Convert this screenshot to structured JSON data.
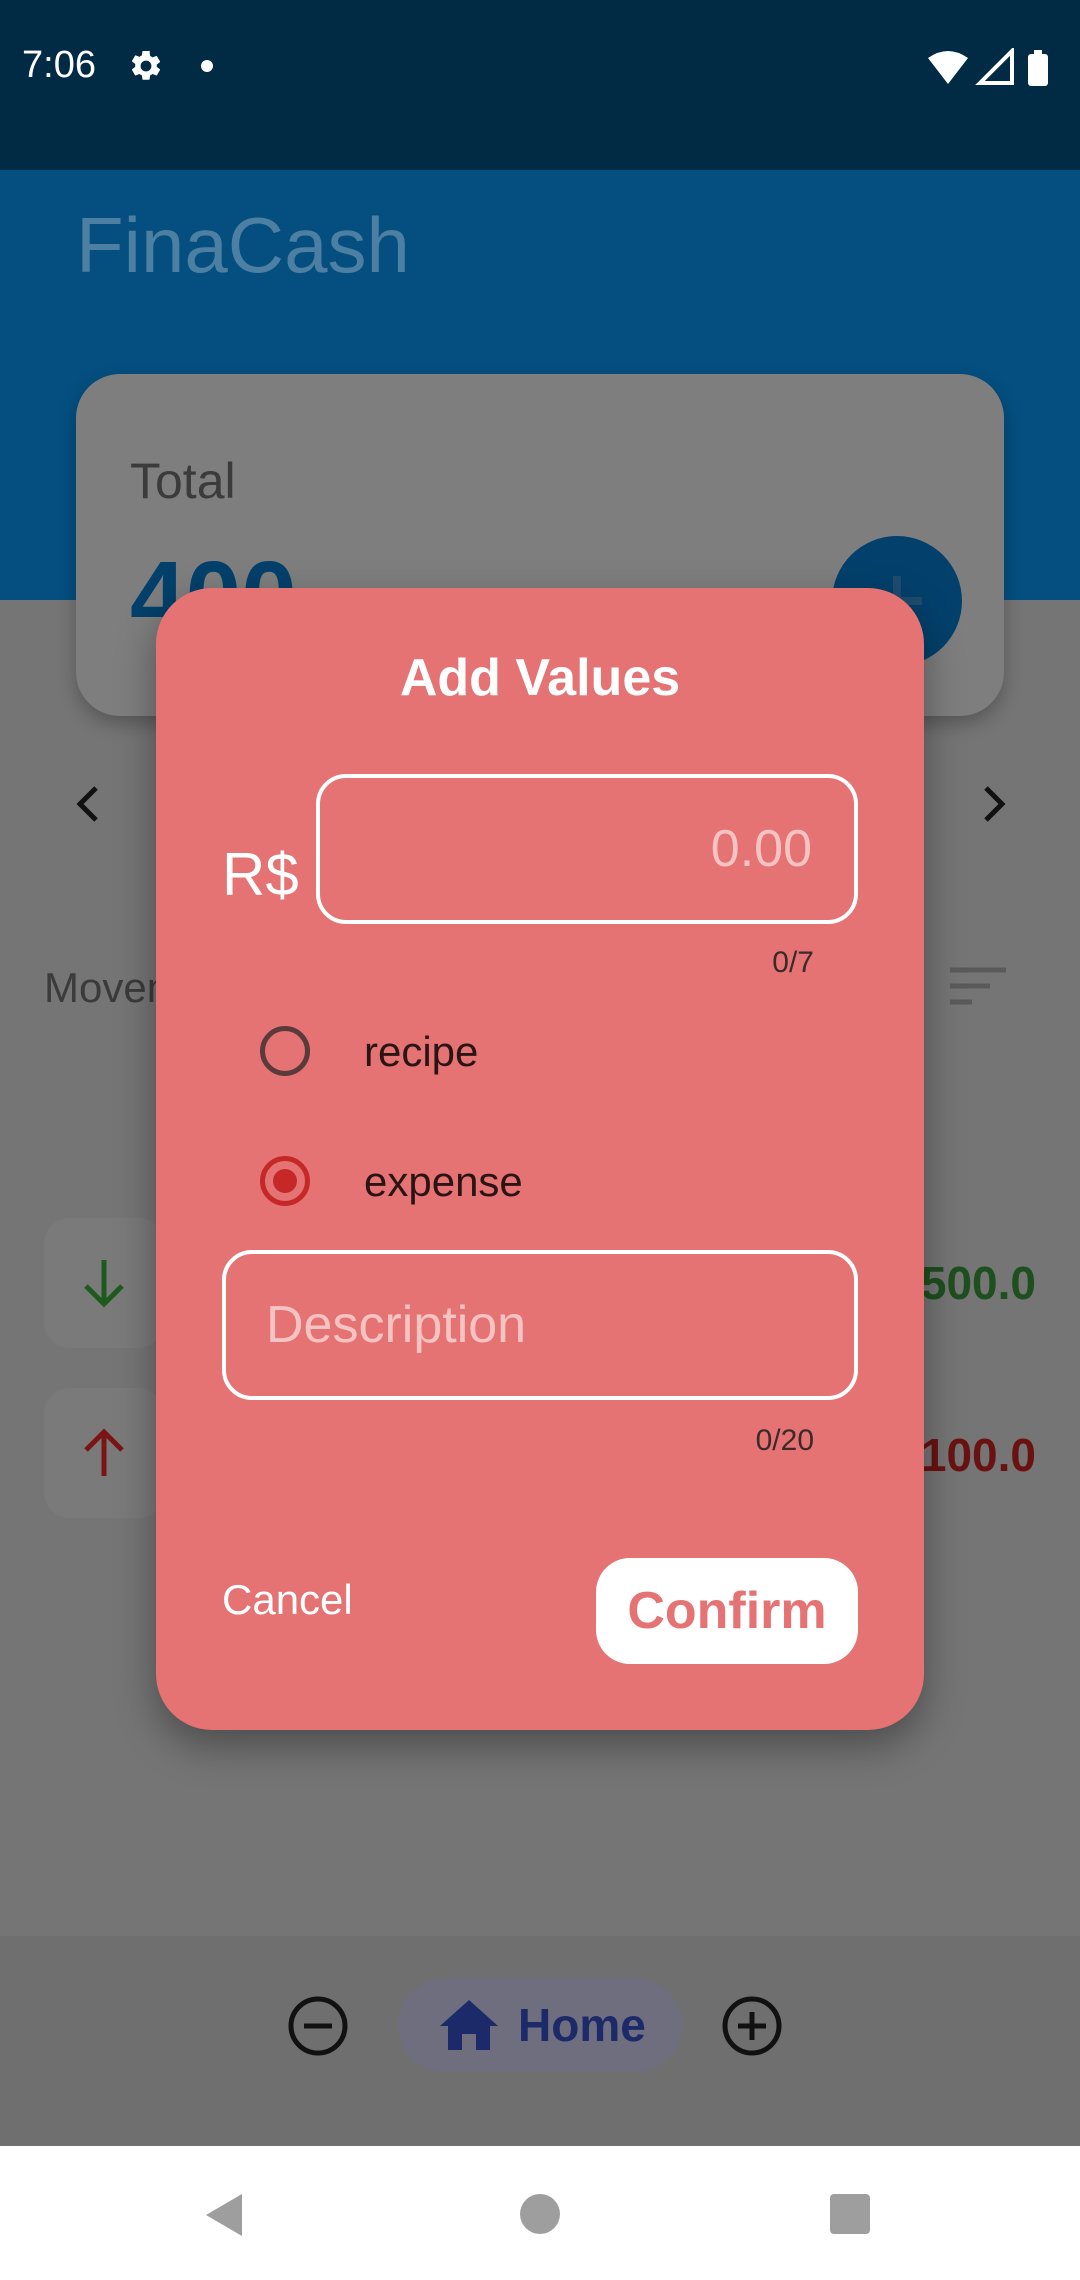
{
  "status_bar": {
    "time": "7:06",
    "icons": [
      "gear-icon",
      "notification-dot-icon",
      "wifi-icon",
      "signal-icon",
      "battery-icon"
    ]
  },
  "app": {
    "title": "FinaCash"
  },
  "total_card": {
    "label": "Total",
    "value": "400"
  },
  "movements": {
    "label": "Movements",
    "items": [
      {
        "type": "income",
        "icon": "arrow-down-icon",
        "amount": "500.0"
      },
      {
        "type": "expense",
        "icon": "arrow-up-icon",
        "amount": "100.0"
      }
    ]
  },
  "bottom_nav": {
    "home_label": "Home",
    "items": [
      "minus-circle-icon",
      "home-icon",
      "plus-circle-icon"
    ]
  },
  "dialog": {
    "title": "Add Values",
    "currency": "R$",
    "amount_placeholder": "0.00",
    "amount_value": "",
    "amount_counter": "0/7",
    "radio_options": [
      {
        "label": "recipe",
        "selected": false
      },
      {
        "label": "expense",
        "selected": true
      }
    ],
    "description_placeholder": "Description",
    "description_value": "",
    "description_counter": "0/20",
    "cancel_label": "Cancel",
    "confirm_label": "Confirm"
  },
  "colors": {
    "dialog_bg": "#e57373",
    "primary": "#03406b",
    "income": "#2e7d32",
    "expense": "#c62828"
  }
}
